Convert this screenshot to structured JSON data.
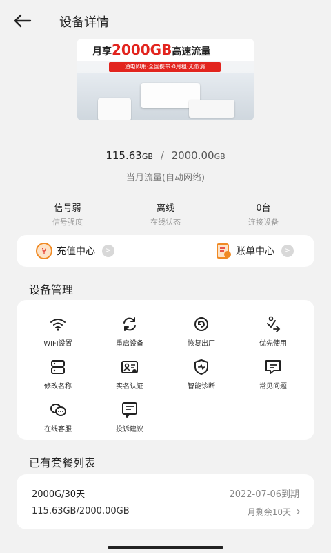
{
  "header": {
    "title": "设备详情"
  },
  "banner": {
    "title_prefix": "月享",
    "title_highlight": "2000GB",
    "title_suffix": "高速流量",
    "subtitle": "通电即用·全国携带·0月租·无低消"
  },
  "usage": {
    "used_value": "115.63",
    "used_unit": "GB",
    "separator": "/",
    "total_value": "2000.00",
    "total_unit": "GB",
    "label": "当月流量(自动网络)"
  },
  "stats": [
    {
      "value": "信号弱",
      "label": "信号强度"
    },
    {
      "value": "离线",
      "label": "在线状态"
    },
    {
      "value": "0台",
      "label": "连接设备"
    }
  ],
  "quick_actions": {
    "recharge": {
      "label": "充值中心"
    },
    "bill": {
      "label": "账单中心"
    }
  },
  "device_management": {
    "title": "设备管理",
    "items": [
      {
        "label": "WIFI设置",
        "icon": "wifi-icon"
      },
      {
        "label": "重启设备",
        "icon": "restart-icon"
      },
      {
        "label": "恢复出厂",
        "icon": "factory-reset-icon"
      },
      {
        "label": "优先使用",
        "icon": "priority-icon"
      },
      {
        "label": "修改名称",
        "icon": "rename-icon"
      },
      {
        "label": "实名认证",
        "icon": "id-card-icon"
      },
      {
        "label": "智能诊断",
        "icon": "shield-icon"
      },
      {
        "label": "常见问题",
        "icon": "faq-icon"
      },
      {
        "label": "在线客服",
        "icon": "chat-icon"
      },
      {
        "label": "投诉建议",
        "icon": "feedback-icon"
      }
    ]
  },
  "plans": {
    "title": "已有套餐列表",
    "items": [
      {
        "name": "2000G/30天",
        "expiry": "2022-07-06到期",
        "usage": "115.63GB/2000.00GB",
        "remaining": "月剩余10天"
      }
    ]
  },
  "colors": {
    "accent": "#e2241e",
    "orange": "#f08a24"
  }
}
